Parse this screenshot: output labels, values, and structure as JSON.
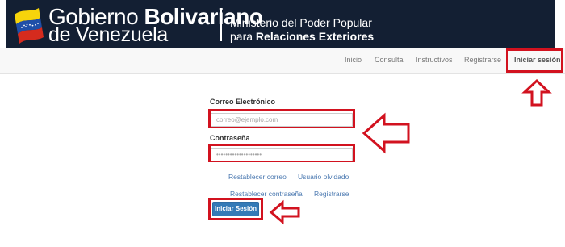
{
  "header": {
    "gov_line1_regular": "Gobierno ",
    "gov_line1_bold": "Bolivariano",
    "gov_line2": "de Venezuela",
    "ministry_line1": "Ministerio del Poder Popular",
    "ministry_line2_regular": "para ",
    "ministry_line2_bold": "Relaciones Exteriores",
    "background_color": "#131f33"
  },
  "nav": {
    "items": [
      {
        "label": "Inicio"
      },
      {
        "label": "Consulta"
      },
      {
        "label": "Instructivos"
      },
      {
        "label": "Registrarse"
      },
      {
        "label": "Iniciar sesión"
      }
    ],
    "active_index": 4
  },
  "login_form": {
    "email_label": "Correo Electrónico",
    "email_placeholder": "correo@ejemplo.com",
    "password_label": "Contraseña",
    "password_placeholder": "••••••••••••••••••••",
    "links": {
      "reset_email": "Restablecer correo",
      "forgot_user": "Usuario olvidado",
      "reset_password": "Restablecer contraseña",
      "register": "Registrarse"
    },
    "submit_label": "Iniciar Sesión"
  },
  "annotations": {
    "highlight_color": "#d2121f",
    "arrow_icon": "outline-arrow-icon"
  }
}
